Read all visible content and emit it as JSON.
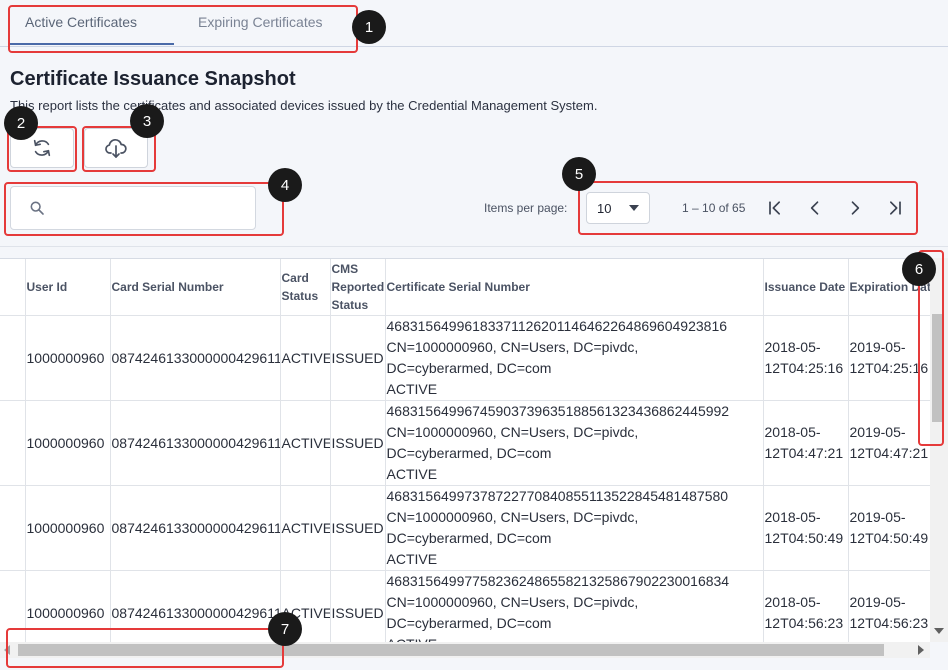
{
  "tabs": [
    {
      "label": "Active Certificates",
      "active": true
    },
    {
      "label": "Expiring Certificates",
      "active": false
    }
  ],
  "header": {
    "title": "Certificate Issuance Snapshot",
    "description": "This report lists the certificates and associated devices issued by the Credential Management System."
  },
  "toolbar": {
    "refresh_icon": "refresh-icon",
    "download_icon": "cloud-download-icon"
  },
  "search": {
    "placeholder": "",
    "value": ""
  },
  "paginator": {
    "items_per_page_label": "Items per page:",
    "items_per_page": "10",
    "range": "1 – 10 of 65"
  },
  "table": {
    "columns": [
      "User Id",
      "Card Serial Number",
      "Card Status",
      "CMS Reported Status",
      "Certificate Serial Number",
      "Issuance Date",
      "Expiration Date"
    ],
    "rows": [
      {
        "user_id": "1000000960",
        "card_serial": "0874246133000000429611",
        "card_status": "ACTIVE",
        "cms_status": "ISSUED",
        "cert_serial": "46831564996183371126201146462264869604923816",
        "cert_subject": "CN=1000000960, CN=Users, DC=pivdc,",
        "cert_subject2": "DC=cyberarmed, DC=com",
        "cert_state": "ACTIVE",
        "issuance_l1": "2018-05-",
        "issuance_l2": "12T04:25:16",
        "expiration_l1": "2019-05-",
        "expiration_l2": "12T04:25:16"
      },
      {
        "user_id": "1000000960",
        "card_serial": "0874246133000000429611",
        "card_status": "ACTIVE",
        "cms_status": "ISSUED",
        "cert_serial": "46831564996745903739635188561323436862445992",
        "cert_subject": "CN=1000000960, CN=Users, DC=pivdc,",
        "cert_subject2": "DC=cyberarmed, DC=com",
        "cert_state": "ACTIVE",
        "issuance_l1": "2018-05-",
        "issuance_l2": "12T04:47:21",
        "expiration_l1": "2019-05-",
        "expiration_l2": "12T04:47:21"
      },
      {
        "user_id": "1000000960",
        "card_serial": "0874246133000000429611",
        "card_status": "ACTIVE",
        "cms_status": "ISSUED",
        "cert_serial": "46831564997378722770840855113522845481487580",
        "cert_subject": "CN=1000000960, CN=Users, DC=pivdc,",
        "cert_subject2": "DC=cyberarmed, DC=com",
        "cert_state": "ACTIVE",
        "issuance_l1": "2018-05-",
        "issuance_l2": "12T04:50:49",
        "expiration_l1": "2019-05-",
        "expiration_l2": "12T04:50:49"
      },
      {
        "user_id": "1000000960",
        "card_serial": "0874246133000000429611",
        "card_status": "ACTIVE",
        "cms_status": "ISSUED",
        "cert_serial": "46831564997758236248655821325867902230016834",
        "cert_subject": "CN=1000000960, CN=Users, DC=pivdc,",
        "cert_subject2": "DC=cyberarmed, DC=com",
        "cert_state": "ACTIVE",
        "issuance_l1": "2018-05-",
        "issuance_l2": "12T04:56:23",
        "expiration_l1": "2019-05-",
        "expiration_l2": "12T04:56:23"
      }
    ]
  },
  "annotations": [
    "1",
    "2",
    "3",
    "4",
    "5",
    "6",
    "7"
  ]
}
